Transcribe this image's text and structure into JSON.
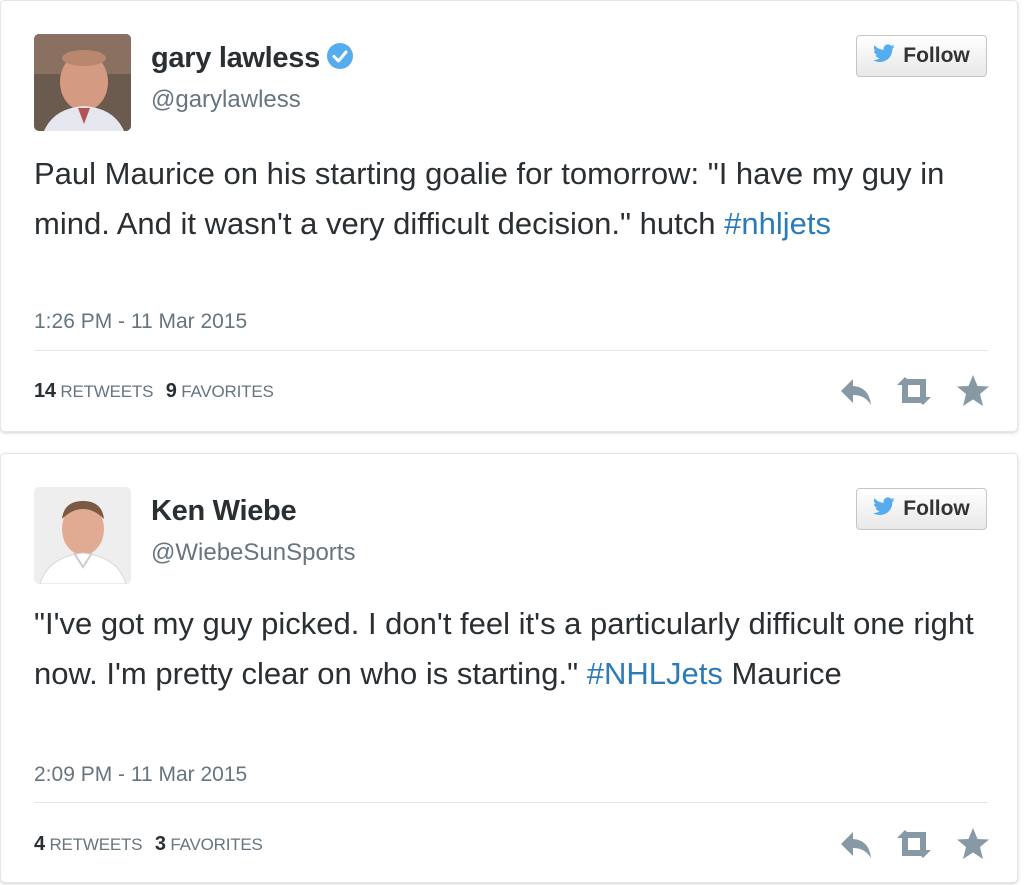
{
  "tweets": [
    {
      "author_name": "gary lawless",
      "verified": true,
      "handle": "@garylawless",
      "follow_label": "Follow",
      "text_before": "Paul Maurice on his starting goalie for tomorrow: \"I have my guy in mind. And it wasn't a very difficult decision.\" hutch ",
      "hashtag": "#nhljets",
      "text_after": "",
      "timestamp": "1:26 PM - 11 Mar 2015",
      "retweets_count": "14",
      "retweets_label": "RETWEETS",
      "favorites_count": "9",
      "favorites_label": "FAVORITES"
    },
    {
      "author_name": "Ken Wiebe",
      "verified": false,
      "handle": "@WiebeSunSports",
      "follow_label": "Follow",
      "text_before": "\"I've got my guy picked. I don't feel it's a particularly difficult one right now. I'm pretty clear on who is starting.\" ",
      "hashtag": "#NHLJets",
      "text_after": " Maurice",
      "timestamp": "2:09 PM - 11 Mar 2015",
      "retweets_count": "4",
      "retweets_label": "RETWEETS",
      "favorites_count": "3",
      "favorites_label": "FAVORITES"
    }
  ],
  "icons": {
    "follow": "twitter-bird-icon",
    "verified": "verified-badge-icon",
    "reply": "reply-icon",
    "retweet": "retweet-icon",
    "favorite": "star-icon"
  },
  "colors": {
    "twitter_blue": "#55acee",
    "hashtag": "#2b7bb9",
    "text": "#292f33",
    "muted": "#66757f",
    "action_icons": "#8899a6"
  }
}
